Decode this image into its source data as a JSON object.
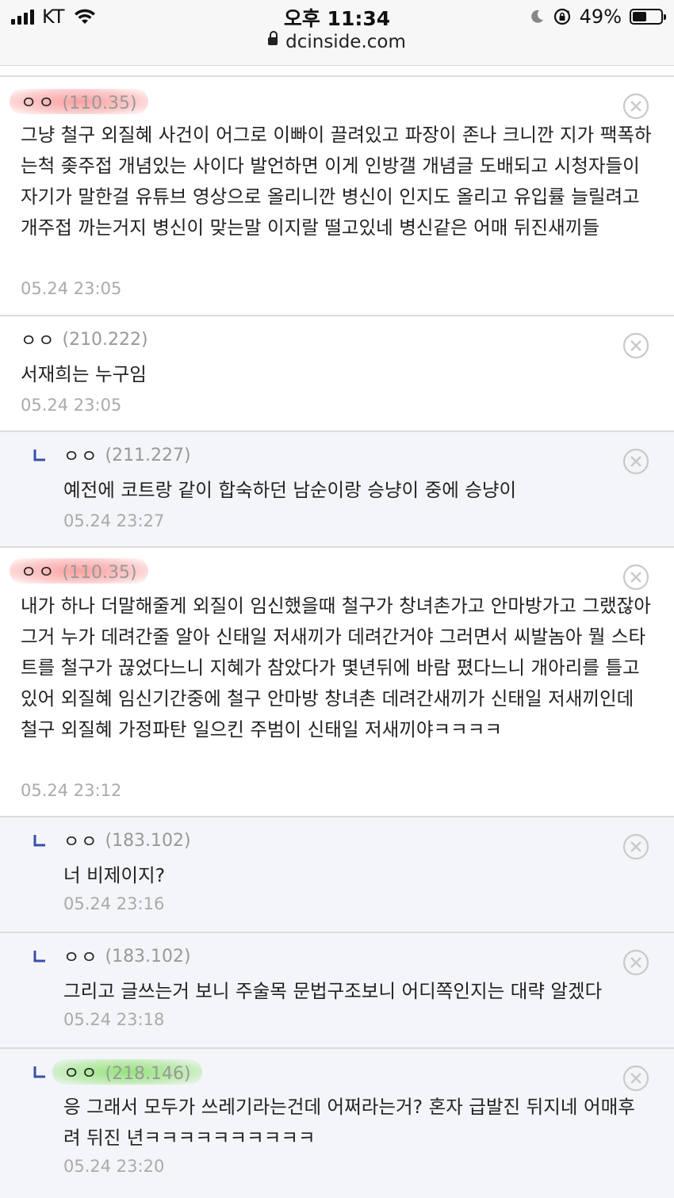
{
  "status_bar": {
    "carrier": "KT",
    "time": "오후 11:34",
    "url": "dcinside.com",
    "battery": "49%",
    "battery_level": 0.49
  },
  "comments": [
    {
      "nick": "ㅇㅇ",
      "ip": "(110.35)",
      "highlight": "red",
      "text": "그냥 철구 외질혜 사건이 어그로 이빠이 끌려있고 파장이 존나 크니깐 지가 팩폭하는척 좆주접 개념있는 사이다 발언하면 이게 인방갤 개념글 도배되고 시청자들이 자기가 말한걸 유튜브 영상으로 올리니깐 병신이 인지도 올리고 유입률 늘릴려고 개주접 까는거지 병신이 맞는말 이지랄 떨고있네 병신같은 어매 뒤진새끼들",
      "date": "05.24 23:05"
    },
    {
      "nick": "ㅇㅇ",
      "ip": "(210.222)",
      "highlight": "",
      "text": "서재희는 누구임",
      "date": "05.24 23:05"
    },
    {
      "nick": "ㅇㅇ",
      "ip": "(211.227)",
      "highlight": "",
      "text": "예전에 코트랑 같이 합숙하던 남순이랑 승냥이 중에 승냥이",
      "date": "05.24 23:27"
    },
    {
      "nick": "ㅇㅇ",
      "ip": "(110.35)",
      "highlight": "red",
      "text": "내가 하나 더말해줄게 외질이 임신했을때 철구가 창녀촌가고 안마방가고 그랬잖아 그거 누가 데려간줄 알아 신태일 저새끼가 데려간거야 그러면서 씨발놈아 뭘 스타트를 철구가 끊었다느니 지혜가 참았다가 몇년뒤에 바람 폈다느니 개아리를 틀고 있어 외질혜 임신기간중에 철구 안마방 창녀촌 데려간새끼가 신태일 저새끼인데 철구 외질혜 가정파탄 일으킨 주범이 신태일 저새끼야ㅋㅋㅋㅋ",
      "date": "05.24 23:12"
    },
    {
      "nick": "ㅇㅇ",
      "ip": "(183.102)",
      "highlight": "",
      "text": "너 비제이지?",
      "date": "05.24 23:16"
    },
    {
      "nick": "ㅇㅇ",
      "ip": "(183.102)",
      "highlight": "",
      "text": "그리고 글쓰는거 보니 주술목 문법구조보니 어디쪽인지는 대략 알겠다",
      "date": "05.24 23:18"
    },
    {
      "nick": "ㅇㅇ",
      "ip": "(218.146)",
      "highlight": "green",
      "text": "응 그래서 모두가 쓰레기라는건데 어쩌라는거? 혼자 급발진 뒤지네 어매후려 뒤진 년ㅋㅋㅋㅋㅋㅋㅋㅋㅋㅋ",
      "date": "05.24 23:20"
    }
  ],
  "colors": {
    "reply_bg": "#f4f5f9",
    "highlight_red": "#f86e6e",
    "highlight_green": "#6edc46",
    "reply_arrow": "#3b4fa8"
  },
  "icons": [
    "signal-icon",
    "wifi-icon",
    "lock-icon",
    "moon-icon",
    "rotation-lock-icon",
    "battery-icon",
    "reply-arrow-icon",
    "delete-x-icon"
  ]
}
